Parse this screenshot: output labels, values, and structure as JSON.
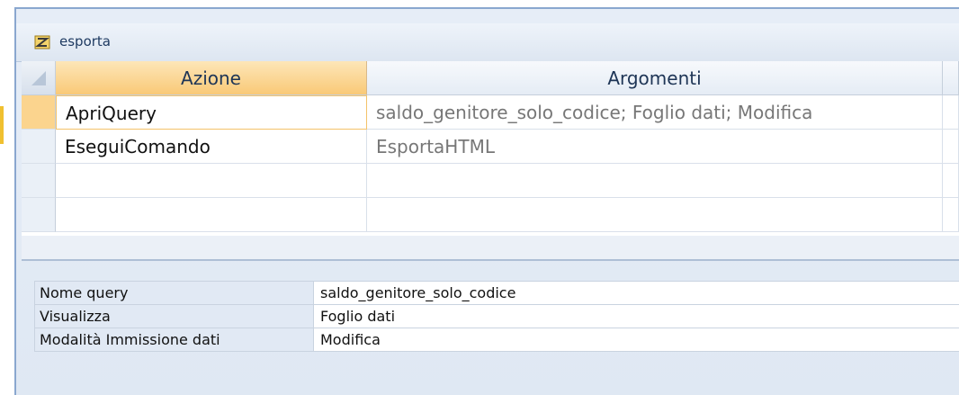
{
  "window": {
    "title": "esporta"
  },
  "grid": {
    "columns": [
      "Azione",
      "Argomenti"
    ],
    "rows": [
      {
        "azione": "ApriQuery",
        "argomenti": "saldo_genitore_solo_codice; Foglio dati; Modifica"
      },
      {
        "azione": "EseguiComando",
        "argomenti": "EsportaHTML"
      },
      {
        "azione": "",
        "argomenti": ""
      },
      {
        "azione": "",
        "argomenti": ""
      }
    ]
  },
  "properties": [
    {
      "label": "Nome query",
      "value": "saldo_genitore_solo_codice"
    },
    {
      "label": "Visualizza",
      "value": "Foglio dati"
    },
    {
      "label": "Modalità Immissione dati",
      "value": "Modifica"
    }
  ],
  "colors": {
    "active_header": "#f9c977",
    "frame_border": "#8aa7cf",
    "panel_bg": "#dfe8f3"
  },
  "icons": {
    "title": "macro-icon",
    "dropdown": "dropdown-arrow-icon"
  }
}
